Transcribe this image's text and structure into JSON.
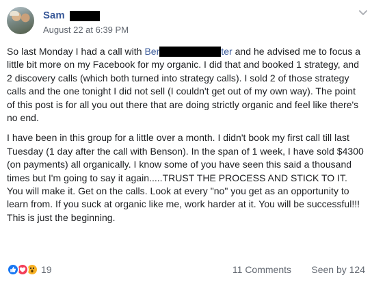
{
  "post": {
    "author": "Sam",
    "timestamp": "August 22 at 6:39 PM",
    "paragraph1": {
      "intro": "So last Monday I had a call with ",
      "mention_start": "Ber",
      "mention_end": "ter",
      "rest": " and he advised me to focus a little bit more on my Facebook for my organic. I did that and booked 1 strategy, and 2 discovery calls (which both turned into strategy calls). I sold 2 of those strategy calls and the one tonight I did not sell (I couldn't get out of my own way). The point of this post is for all you out there that are doing strictly organic and feel like there's no end."
    },
    "paragraph2": "I have been in this group for a little over a month. I didn't book my first call till last Tuesday (1 day after the call with Benson). In the span of 1 week, I have sold $4300 (on payments) all organically. I know some of you have seen this said a thousand times but I'm going to say it again.....TRUST THE PROCESS AND STICK TO IT. You will make it. Get on the calls. Look at every \"no\" you get as an opportunity to learn from. If you suck at organic like me, work harder at it. You will be successful!!! This is just the beginning.",
    "reactions": {
      "icons": [
        "like-icon",
        "love-icon",
        "wow-icon"
      ],
      "count": "19"
    },
    "comments": "11 Comments",
    "seen_by": "Seen by 124"
  },
  "colors": {
    "link": "#385898",
    "meta": "#616770",
    "like": "#1877f2",
    "love": "#f33e58",
    "wow": "#f7b125"
  }
}
